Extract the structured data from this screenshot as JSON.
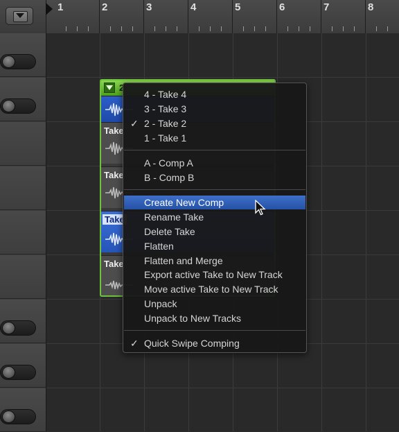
{
  "ruler": {
    "bars": [
      "1",
      "2",
      "3",
      "4",
      "5",
      "6",
      "7",
      "8"
    ]
  },
  "take_folder": {
    "number": "2",
    "lanes": [
      {
        "label": "",
        "state": "active"
      },
      {
        "label": "Take",
        "state": "inactive"
      },
      {
        "label": "Take",
        "state": "inactive"
      },
      {
        "label": "Take",
        "state": "selected"
      },
      {
        "label": "Take",
        "state": "inactive"
      }
    ]
  },
  "menu": {
    "takes": [
      {
        "label": "4 - Take 4",
        "checked": false
      },
      {
        "label": "3 - Take 3",
        "checked": false
      },
      {
        "label": "2 - Take 2",
        "checked": true
      },
      {
        "label": "1 - Take 1",
        "checked": false
      }
    ],
    "comps": [
      {
        "label": "A - Comp A"
      },
      {
        "label": "B - Comp B"
      }
    ],
    "actions": [
      {
        "label": "Create New Comp",
        "highlighted": true
      },
      {
        "label": "Rename Take"
      },
      {
        "label": "Delete Take"
      },
      {
        "label": "Flatten"
      },
      {
        "label": "Flatten and Merge"
      },
      {
        "label": "Export active Take to New Track"
      },
      {
        "label": "Move active Take to New Track"
      },
      {
        "label": "Unpack"
      },
      {
        "label": "Unpack to New Tracks"
      }
    ],
    "options": [
      {
        "label": "Quick Swipe Comping",
        "checked": true
      }
    ],
    "check_glyph": "✓"
  },
  "colors": {
    "take_folder_green": "#6fc23c",
    "active_take_blue": "#2c5ec9",
    "menu_highlight": "#2f5fb8"
  },
  "icons": {
    "collapse": "triangle-down-icon",
    "playhead": "playhead-icon",
    "cursor": "pointer-cursor-icon"
  }
}
